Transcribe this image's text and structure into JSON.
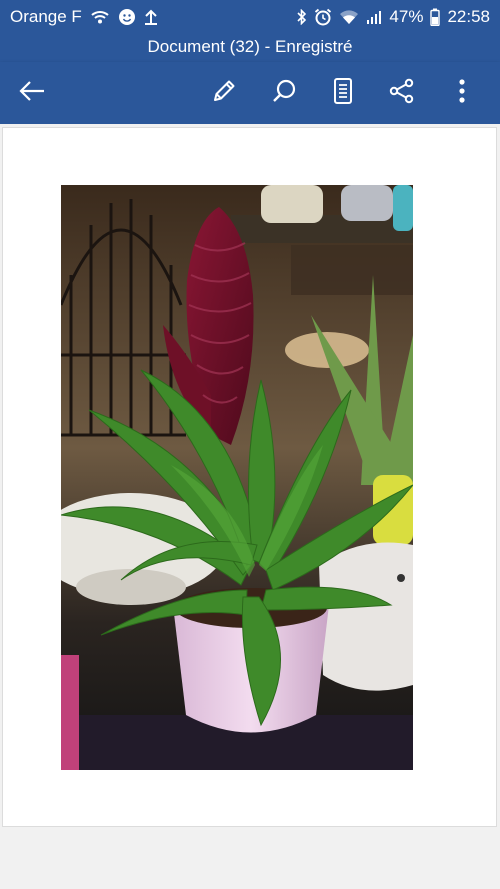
{
  "status_bar": {
    "carrier": "Orange F",
    "battery": "47%",
    "time": "22:58"
  },
  "document": {
    "title": "Document (32) - Enregistré"
  },
  "toolbar": {
    "icons": [
      "back-arrow-icon",
      "edit-pencil-icon",
      "search-icon",
      "reading-view-icon",
      "share-icon",
      "more-vertical-icon"
    ]
  },
  "colors": {
    "app_bar": "#2b579a",
    "page_bg": "#ffffff",
    "workspace_bg": "#f1f1f1"
  }
}
